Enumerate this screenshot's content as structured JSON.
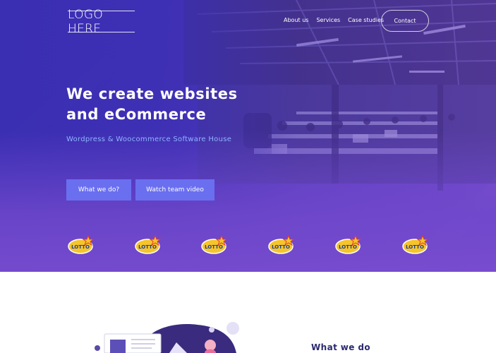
{
  "header": {
    "logo_text": "LOGO HERE",
    "nav": [
      "About us",
      "Services",
      "Case studies"
    ],
    "contact_label": "Contact"
  },
  "hero": {
    "headline_line1": "We create websites",
    "headline_line2": "and eCommerce",
    "subline": "Wordpress & Woocommerce Software House",
    "primary_button": "What we do?",
    "secondary_button": "Watch team video",
    "client_logos": [
      "LOTTO",
      "LOTTO",
      "LOTTO",
      "LOTTO",
      "LOTTO",
      "LOTTO"
    ]
  },
  "section": {
    "title": "What we do"
  },
  "colors": {
    "hero_start": "#3a2fb0",
    "hero_end": "#7a4cc8",
    "button_bg": "#6a6ff0",
    "subline": "#8fb4ff",
    "section_title": "#2c2a6e"
  }
}
